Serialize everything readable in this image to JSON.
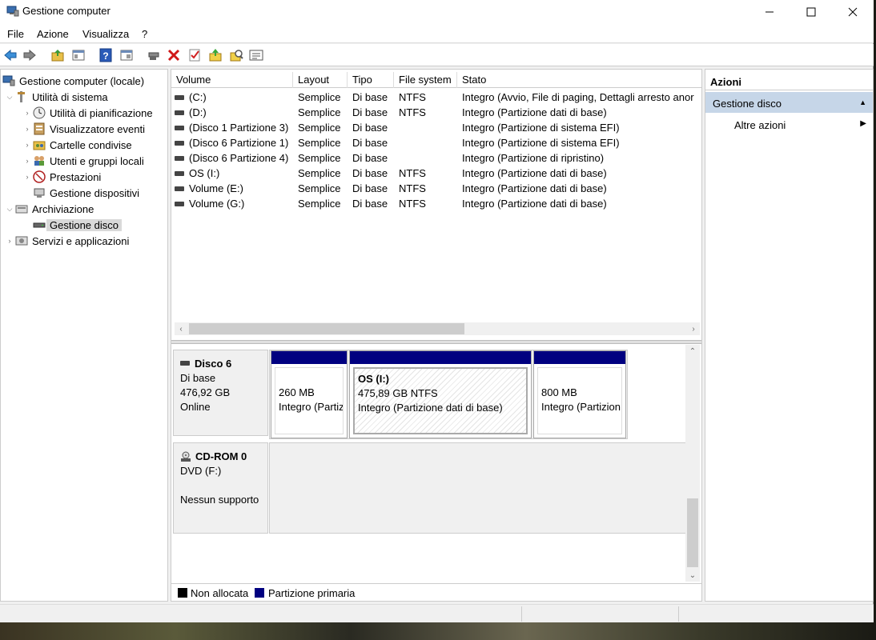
{
  "window": {
    "title": "Gestione computer"
  },
  "menu": [
    "File",
    "Azione",
    "Visualizza",
    "?"
  ],
  "toolbar": {
    "icons": [
      "back-arrow-icon",
      "forward-arrow-icon",
      "folder-up-icon",
      "properties-pane-icon",
      "help-icon",
      "console-icon",
      "connect-drive-icon",
      "delete-icon",
      "checklist-icon",
      "folder-arrow-icon",
      "search-folder-icon",
      "list-view-icon"
    ]
  },
  "tree": {
    "root": "Gestione computer (locale)",
    "system_tools": "Utilità di sistema",
    "items": [
      "Utilità di pianificazione",
      "Visualizzatore eventi",
      "Cartelle condivise",
      "Utenti e gruppi locali",
      "Prestazioni",
      "Gestione dispositivi"
    ],
    "storage": "Archiviazione",
    "disk_mgmt": "Gestione disco",
    "services": "Servizi e applicazioni"
  },
  "volumes": {
    "headers": [
      "Volume",
      "Layout",
      "Tipo",
      "File system",
      "Stato"
    ],
    "rows": [
      [
        "(C:)",
        "Semplice",
        "Di base",
        "NTFS",
        "Integro (Avvio, File di paging, Dettagli arresto anor"
      ],
      [
        "(D:)",
        "Semplice",
        "Di base",
        "NTFS",
        "Integro (Partizione dati di base)"
      ],
      [
        "(Disco 1 Partizione 3)",
        "Semplice",
        "Di base",
        "",
        "Integro (Partizione di sistema EFI)"
      ],
      [
        "(Disco 6 Partizione 1)",
        "Semplice",
        "Di base",
        "",
        "Integro (Partizione di sistema EFI)"
      ],
      [
        "(Disco 6 Partizione 4)",
        "Semplice",
        "Di base",
        "",
        "Integro (Partizione di ripristino)"
      ],
      [
        "OS (I:)",
        "Semplice",
        "Di base",
        "NTFS",
        "Integro (Partizione dati di base)"
      ],
      [
        "Volume (E:)",
        "Semplice",
        "Di base",
        "NTFS",
        "Integro (Partizione dati di base)"
      ],
      [
        "Volume (G:)",
        "Semplice",
        "Di base",
        "NTFS",
        "Integro (Partizione dati di base)"
      ]
    ]
  },
  "disk6": {
    "name": "Disco 6",
    "type": "Di base",
    "size": "476,92 GB",
    "status": "Online",
    "partitions": [
      {
        "title": "",
        "size": "260 MB",
        "status": "Integro (Partiz"
      },
      {
        "title": "OS  (I:)",
        "size": "475,89 GB NTFS",
        "status": "Integro (Partizione dati di base)"
      },
      {
        "title": "",
        "size": "800 MB",
        "status": "Integro (Partizion"
      }
    ]
  },
  "cdrom": {
    "name": "CD-ROM 0",
    "drive": "DVD (F:)",
    "status": "Nessun supporto"
  },
  "legend": {
    "unallocated": "Non allocata",
    "primary": "Partizione primaria"
  },
  "actions": {
    "title": "Azioni",
    "section": "Gestione disco",
    "more": "Altre azioni"
  },
  "colors": {
    "primary_partition": "#000080",
    "unallocated": "#000000",
    "selection": "#c6d6e8"
  }
}
